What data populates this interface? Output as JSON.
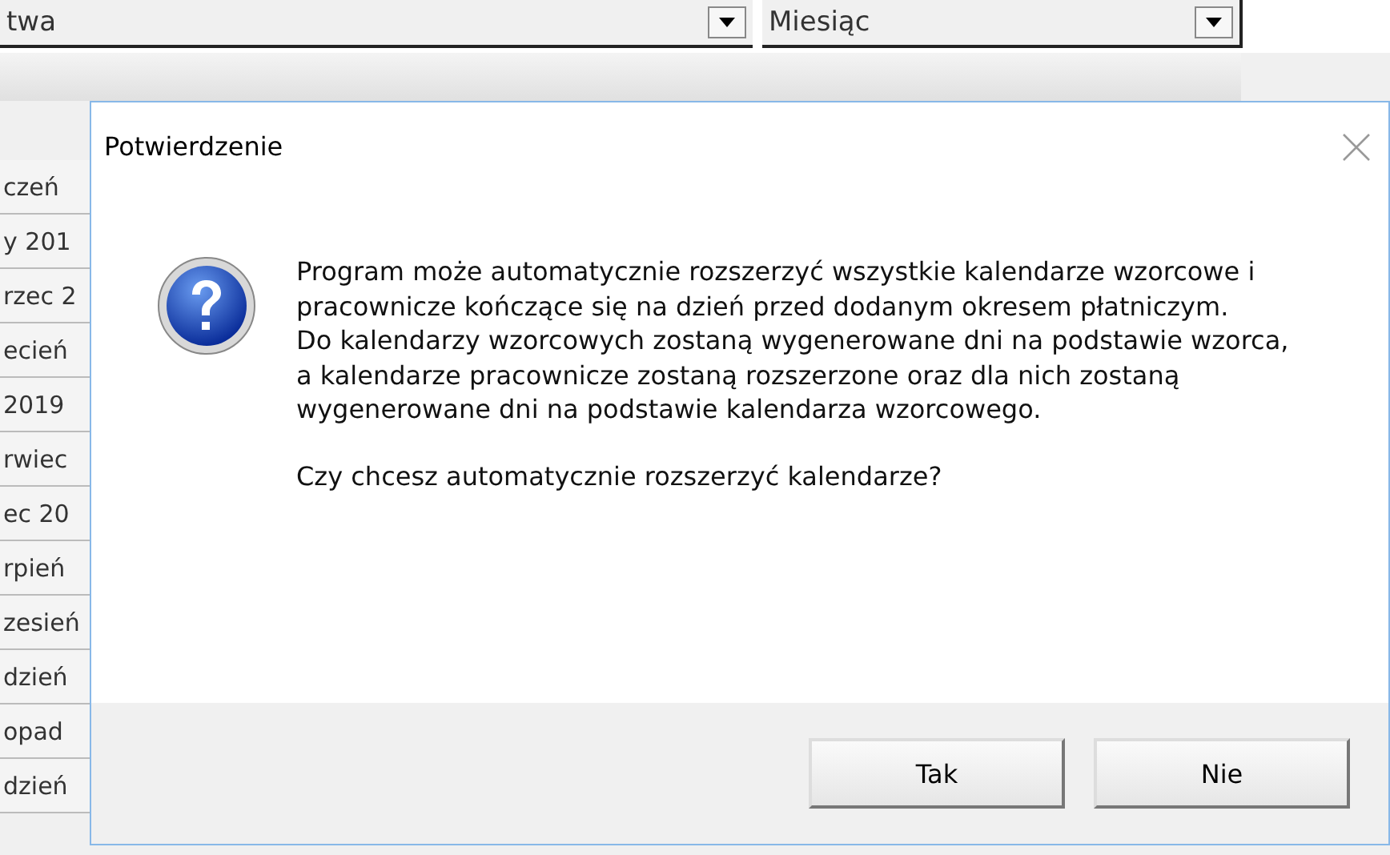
{
  "background": {
    "combo_1": {
      "value": "twa"
    },
    "combo_2": {
      "value": "Miesiąc"
    },
    "list_items": [
      "czeń",
      "y 201",
      "rzec 2",
      "ecień",
      "2019",
      "rwiec",
      "ec 20",
      "rpień",
      "zesień",
      "dzień",
      "opad",
      "dzień"
    ]
  },
  "dialog": {
    "title": "Potwierdzenie",
    "paragraphs": [
      "Program może automatycznie rozszerzyć wszystkie kalendarze wzorcowe i pracownicze kończące się na dzień przed dodanym okresem płatniczym.\nDo kalendarzy wzorcowych zostaną wygenerowane dni na podstawie wzorca, a kalendarze pracownicze zostaną rozszerzone oraz dla nich zostaną wygenerowane dni na podstawie kalendarza wzorcowego.",
      "Czy chcesz automatycznie rozszerzyć kalendarze?"
    ],
    "buttons": [
      "Tak",
      "Nie"
    ]
  }
}
